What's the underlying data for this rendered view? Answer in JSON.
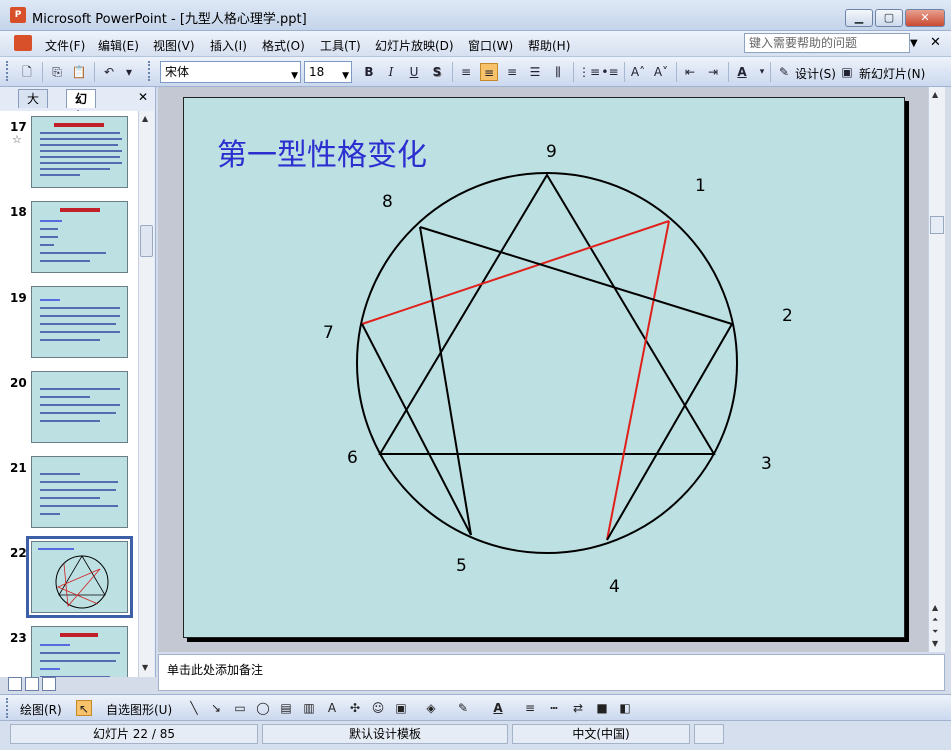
{
  "window": {
    "title": "Microsoft PowerPoint - [九型人格心理学.ppt]",
    "min_label": "▁",
    "max_label": "▢",
    "close_label": "✕"
  },
  "menu": {
    "items": [
      "文件(F)",
      "编辑(E)",
      "视图(V)",
      "插入(I)",
      "格式(O)",
      "工具(T)",
      "幻灯片放映(D)",
      "窗口(W)",
      "帮助(H)"
    ],
    "help_placeholder": "键入需要帮助的问题"
  },
  "toolbar": {
    "font_name": "宋体",
    "font_size": "18",
    "bold": "B",
    "italic": "I",
    "underline": "U",
    "shadow": "S",
    "design_label": "设计(S)",
    "new_slide_label": "新幻灯片(N)"
  },
  "left_panel": {
    "tabs": [
      "大纲",
      "幻灯片"
    ],
    "close_label": "✕",
    "slides": [
      {
        "num": "17",
        "star": "☆"
      },
      {
        "num": "18",
        "star": ""
      },
      {
        "num": "19",
        "star": ""
      },
      {
        "num": "20",
        "star": ""
      },
      {
        "num": "21",
        "star": ""
      },
      {
        "num": "22",
        "star": ""
      },
      {
        "num": "23",
        "star": ""
      }
    ],
    "selected_slide": "22"
  },
  "slide": {
    "title": "第一型性格变化",
    "labels": {
      "n9": "9",
      "n1": "1",
      "n2": "2",
      "n3": "3",
      "n4": "4",
      "n5": "5",
      "n6": "6",
      "n7": "7",
      "n8": "8"
    },
    "colors": {
      "background": "#bde0e3",
      "title": "#2c2ed0",
      "line": "#000000",
      "highlight": "#e0201a"
    }
  },
  "notes": {
    "placeholder": "单击此处添加备注"
  },
  "drawbar": {
    "draw_label": "绘图(R)",
    "autoshape_label": "自选图形(U)"
  },
  "status": {
    "slide_info": "幻灯片 22 / 85",
    "template": "默认设计模板",
    "language": "中文(中国)"
  }
}
